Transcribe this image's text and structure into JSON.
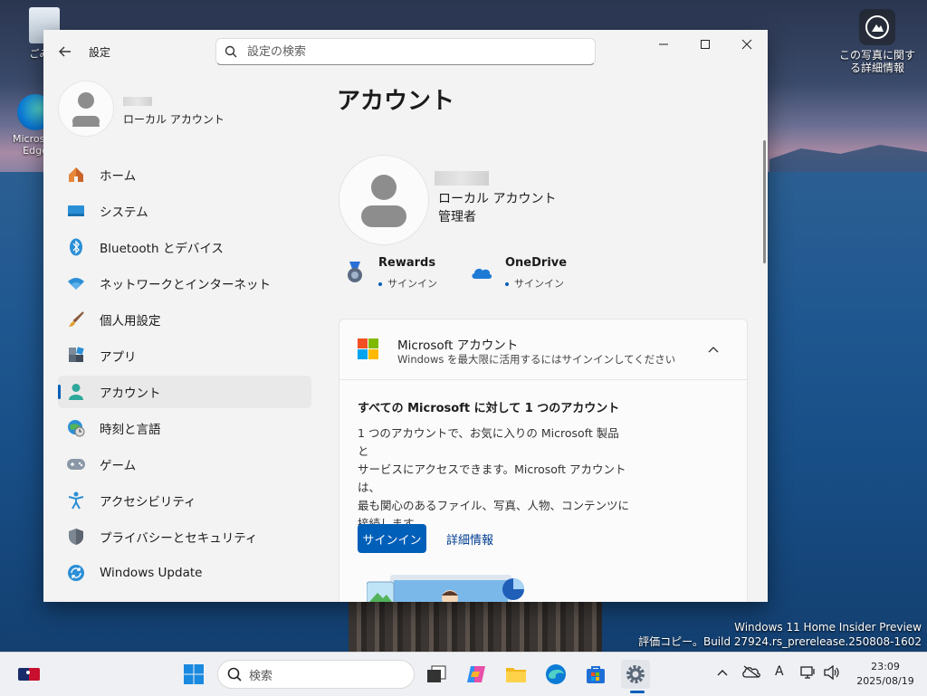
{
  "desktop": {
    "icon_recycle_label": "ごみ箱",
    "icon_edge_label": "Microsoft Edge",
    "photo_info_label": "この写真に関する詳細情報",
    "watermark_line1": "Windows 11 Home Insider Preview",
    "watermark_line2": "評価コピー。Build 27924.rs_prerelease.250808-1602"
  },
  "window": {
    "app_title": "設定",
    "search_placeholder": "設定の検索",
    "profile_account_type": "ローカル アカウント",
    "nav": [
      {
        "label": "ホーム",
        "icon": "home-icon"
      },
      {
        "label": "システム",
        "icon": "system-icon"
      },
      {
        "label": "Bluetooth とデバイス",
        "icon": "bluetooth-icon"
      },
      {
        "label": "ネットワークとインターネット",
        "icon": "wifi-icon"
      },
      {
        "label": "個人用設定",
        "icon": "brush-icon"
      },
      {
        "label": "アプリ",
        "icon": "apps-icon"
      },
      {
        "label": "アカウント",
        "icon": "account-icon"
      },
      {
        "label": "時刻と言語",
        "icon": "globe-clock-icon"
      },
      {
        "label": "ゲーム",
        "icon": "gamepad-icon"
      },
      {
        "label": "アクセシビリティ",
        "icon": "accessibility-icon"
      },
      {
        "label": "プライバシーとセキュリティ",
        "icon": "shield-icon"
      },
      {
        "label": "Windows Update",
        "icon": "update-icon"
      }
    ],
    "active_nav": "アカウント"
  },
  "content": {
    "page_title": "アカウント",
    "account_type": "ローカル アカウント",
    "account_role": "管理者",
    "rewards_name": "Rewards",
    "rewards_status": "サインイン",
    "onedrive_name": "OneDrive",
    "onedrive_status": "サインイン",
    "card_title": "Microsoft アカウント",
    "card_subtitle": "Windows を最大限に活用するにはサインインしてください",
    "card_body_title": "すべての Microsoft に対して 1 つのアカウント",
    "card_body_line1": "1 つのアカウントで、お気に入りの Microsoft 製品と",
    "card_body_line2": "サービスにアクセスできます。Microsoft アカウントは、",
    "card_body_line3": "最も関心のあるファイル、写真、人物、コンテンツに",
    "card_body_line4": "接続します。",
    "signin_label": "サインイン",
    "more_info_label": "詳細情報"
  },
  "taskbar": {
    "search_placeholder": "検索",
    "time": "23:09",
    "date": "2025/08/19",
    "ime_label": "A"
  },
  "colors": {
    "accent": "#005fb8",
    "ms_red": "#f25022",
    "ms_green": "#7fba00",
    "ms_blue": "#00a4ef",
    "ms_yellow": "#ffb900"
  }
}
